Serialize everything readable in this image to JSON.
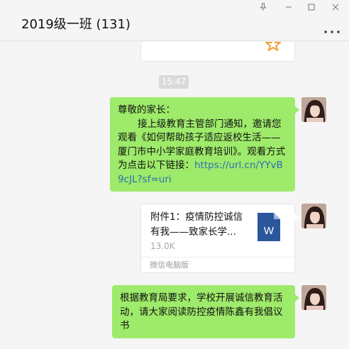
{
  "window": {
    "title": "2019级一班 (131)",
    "controls": [
      "pin-icon",
      "minimize-icon",
      "maximize-icon",
      "close-icon"
    ],
    "more_icon": "more-icon"
  },
  "messages": {
    "timestamp": "15:47",
    "m1": {
      "greeting": "尊敬的家长：",
      "body": "接上级教育主管部门通知，邀请您观看《如何帮助孩子适应返校生活——厦门市中小学家庭教育培训》。观看方式为点击以下链接：",
      "link": "https://url.cn/YYvB9cJL?sf=uri"
    },
    "file": {
      "title": "附件1：疫情防控诚信有我——致家长学...",
      "size": "13.0K",
      "source": "微信电脑版",
      "icon_letter": "W"
    },
    "m3": {
      "text": "根据教育局要求，学校开展诚信教育活动，请大家阅读防控疫情陈鑫有我倡议书"
    }
  },
  "colors": {
    "bubble_green": "#9eea6a",
    "link": "#2b6fb3",
    "word_blue": "#2b579a",
    "background": "#f5f5f5"
  }
}
